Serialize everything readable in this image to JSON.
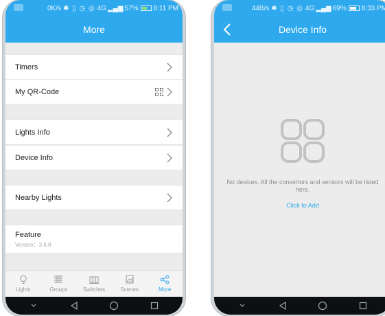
{
  "left_phone": {
    "status": {
      "speed": "0K/s",
      "signal": "4G",
      "battery": "57%",
      "time": "8:11 PM"
    },
    "title": "More",
    "menu": {
      "timers": "Timers",
      "qr_code": "My QR-Code",
      "lights_info": "Lights Info",
      "device_info": "Device Info",
      "nearby_lights": "Nearby Lights",
      "feature_title": "Feature",
      "feature_version": "Version：3.8.8"
    },
    "tabs": [
      {
        "label": "Lights",
        "icon": "bulb-icon"
      },
      {
        "label": "Groups",
        "icon": "groups-icon"
      },
      {
        "label": "Switches",
        "icon": "switch-icon"
      },
      {
        "label": "Scenes",
        "icon": "scene-icon"
      },
      {
        "label": "More",
        "icon": "share-icon",
        "active": true
      }
    ]
  },
  "right_phone": {
    "status": {
      "speed": "44B/s",
      "signal": "4G",
      "battery": "69%",
      "time": "8:33 PM"
    },
    "title": "Device Info",
    "empty_message": "No devices. All the convertors and sensors will be listed here.",
    "add_link": "Click to Add"
  },
  "colors": {
    "accent": "#2ea9ee",
    "background": "#ececec",
    "row_bg": "#ffffff",
    "muted_text": "#8e8e8e"
  }
}
